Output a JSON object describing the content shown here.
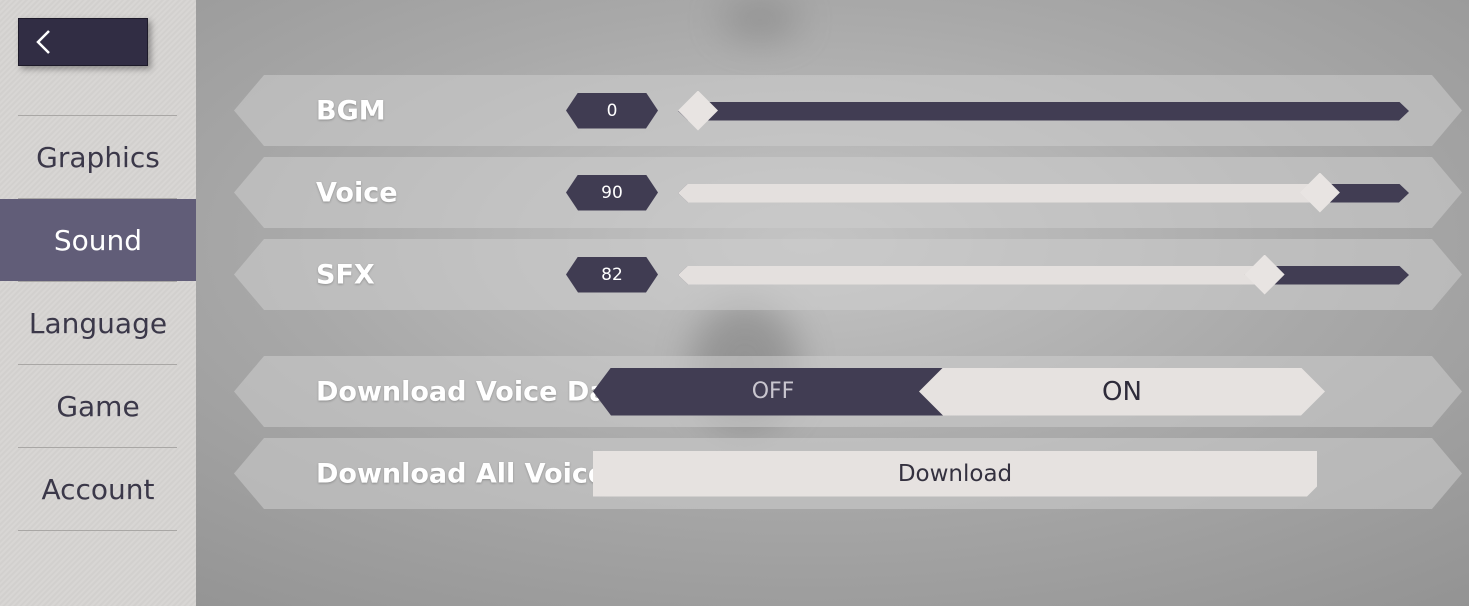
{
  "sidebar": {
    "back_icon": "chevron-left-icon",
    "items": [
      {
        "label": "Graphics",
        "active": false
      },
      {
        "label": "Sound",
        "active": true
      },
      {
        "label": "Language",
        "active": false
      },
      {
        "label": "Game",
        "active": false
      },
      {
        "label": "Account",
        "active": false
      }
    ]
  },
  "sound": {
    "bgm": {
      "label": "BGM",
      "value": "0"
    },
    "voice": {
      "label": "Voice",
      "value": "90"
    },
    "sfx": {
      "label": "SFX",
      "value": "82"
    },
    "download_voice_data": {
      "label": "Download Voice Data",
      "off_label": "OFF",
      "on_label": "ON",
      "selected": "ON"
    },
    "download_all_voices": {
      "label": "Download All Voices",
      "button_label": "Download"
    }
  },
  "colors": {
    "accent_dark": "#413d53",
    "active_tab": "#615d78",
    "light_fill": "#e6e2e0"
  }
}
